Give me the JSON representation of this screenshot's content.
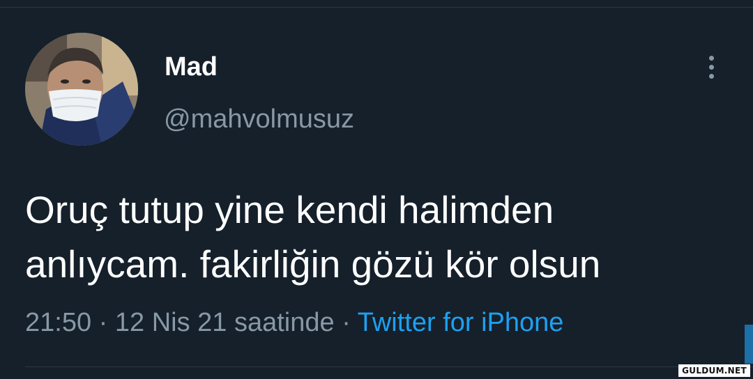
{
  "tweet": {
    "author": {
      "display_name": "Mad",
      "handle": "@mahvolmusuz",
      "avatar_icon": "profile-photo"
    },
    "text_lines": [
      "Oruç tutup yine kendi halimden",
      "anlıycam. fakirliğin gözü kör olsun"
    ],
    "meta": {
      "time": "21:50",
      "separator": " · ",
      "date": "12 Nis 21 saatinde",
      "separator2": " · ",
      "source": "Twitter for iPhone"
    },
    "menu_icon": "more-vertical-icon"
  },
  "watermark": "GULDUM.NET",
  "colors": {
    "background": "#15202b",
    "primary_text": "#ffffff",
    "secondary_text": "#8899a6",
    "link": "#1da1f2"
  }
}
